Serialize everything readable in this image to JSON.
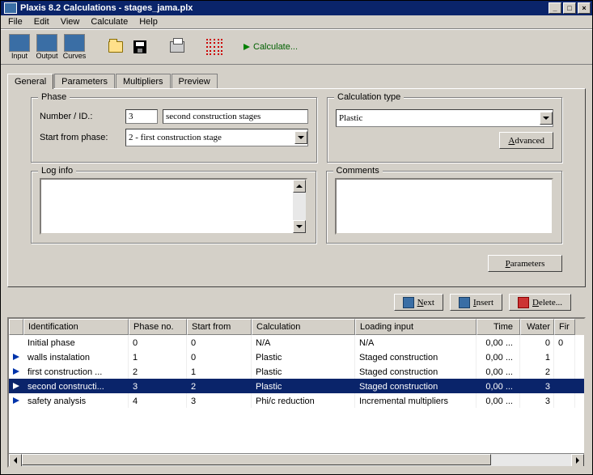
{
  "title": "Plaxis 8.2 Calculations - stages_jama.plx",
  "menu": [
    "File",
    "Edit",
    "View",
    "Calculate",
    "Help"
  ],
  "toolbar": {
    "input": "Input",
    "output": "Output",
    "curves": "Curves",
    "calculate": "Calculate..."
  },
  "tabs": {
    "general": "General",
    "parameters": "Parameters",
    "multipliers": "Multipliers",
    "preview": "Preview"
  },
  "phase_group": {
    "title": "Phase",
    "number_label": "Number / ID.:",
    "number_value": "3",
    "name_value": "second construction stages",
    "start_label": "Start from phase:",
    "start_value": "2 - first construction stage"
  },
  "calc_type_group": {
    "title": "Calculation type",
    "value": "Plastic",
    "advanced": "Advanced"
  },
  "log_group": {
    "title": "Log info",
    "value": ""
  },
  "comments_group": {
    "title": "Comments",
    "value": ""
  },
  "parameters_btn": "Parameters",
  "action_buttons": {
    "next": "Next",
    "insert": "Insert",
    "delete": "Delete..."
  },
  "grid": {
    "headers": {
      "identification": "Identification",
      "phase_no": "Phase no.",
      "start_from": "Start from",
      "calculation": "Calculation",
      "loading_input": "Loading input",
      "time": "Time",
      "water": "Water",
      "fi": "Fir"
    },
    "rows": [
      {
        "icon": "none",
        "id": "Initial phase",
        "phase": "0",
        "start": "0",
        "calc": "N/A",
        "loading": "N/A",
        "time": "0,00 ...",
        "water": "0",
        "fi": "0"
      },
      {
        "icon": "arrow",
        "id": "walls instalation",
        "phase": "1",
        "start": "0",
        "calc": "Plastic",
        "loading": "Staged construction",
        "time": "0,00 ...",
        "water": "1",
        "fi": ""
      },
      {
        "icon": "arrow",
        "id": "first construction ...",
        "phase": "2",
        "start": "1",
        "calc": "Plastic",
        "loading": "Staged construction",
        "time": "0,00 ...",
        "water": "2",
        "fi": ""
      },
      {
        "icon": "arrow",
        "id": "second constructi...",
        "phase": "3",
        "start": "2",
        "calc": "Plastic",
        "loading": "Staged construction",
        "time": "0,00 ...",
        "water": "3",
        "fi": "",
        "selected": true
      },
      {
        "icon": "arrow",
        "id": "safety analysis",
        "phase": "4",
        "start": "3",
        "calc": "Phi/c reduction",
        "loading": "Incremental multipliers",
        "time": "0,00 ...",
        "water": "3",
        "fi": ""
      }
    ]
  }
}
